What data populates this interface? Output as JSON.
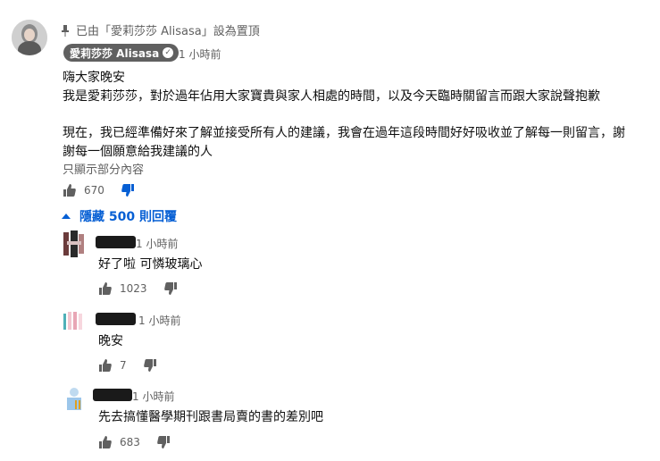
{
  "pinned": {
    "text": "已由「愛莉莎莎 Alisasa」設為置頂",
    "icon": "pin-icon"
  },
  "main_comment": {
    "author": "愛莉莎莎 Alisasa",
    "verified_icon": "check-circle-icon",
    "time": "1 小時前",
    "lines": [
      "嗨大家晚安",
      "我是愛莉莎莎，對於過年佔用大家寶貴與家人相處的時間，以及今天臨時關留言而跟大家說聲抱歉",
      "現在，我已經準備好來了解並接受所有人的建議，我會在過年這段時間好好吸收並了解每一則留言，謝",
      "謝每一個願意給我建議的人"
    ],
    "read_more": "只顯示部分內容",
    "likes": "670",
    "toggle_replies": "隱藏 500 則回覆",
    "accent_color": "#065fd4"
  },
  "replies": [
    {
      "time": "1 小時前",
      "text": "好了啦 可憐玻璃心",
      "likes": "1023"
    },
    {
      "time": "1 小時前",
      "text": "晚安",
      "likes": "7"
    },
    {
      "time": "1 小時前",
      "text": "先去搞懂醫學期刊跟書局賣的書的差別吧",
      "likes": "683"
    }
  ]
}
